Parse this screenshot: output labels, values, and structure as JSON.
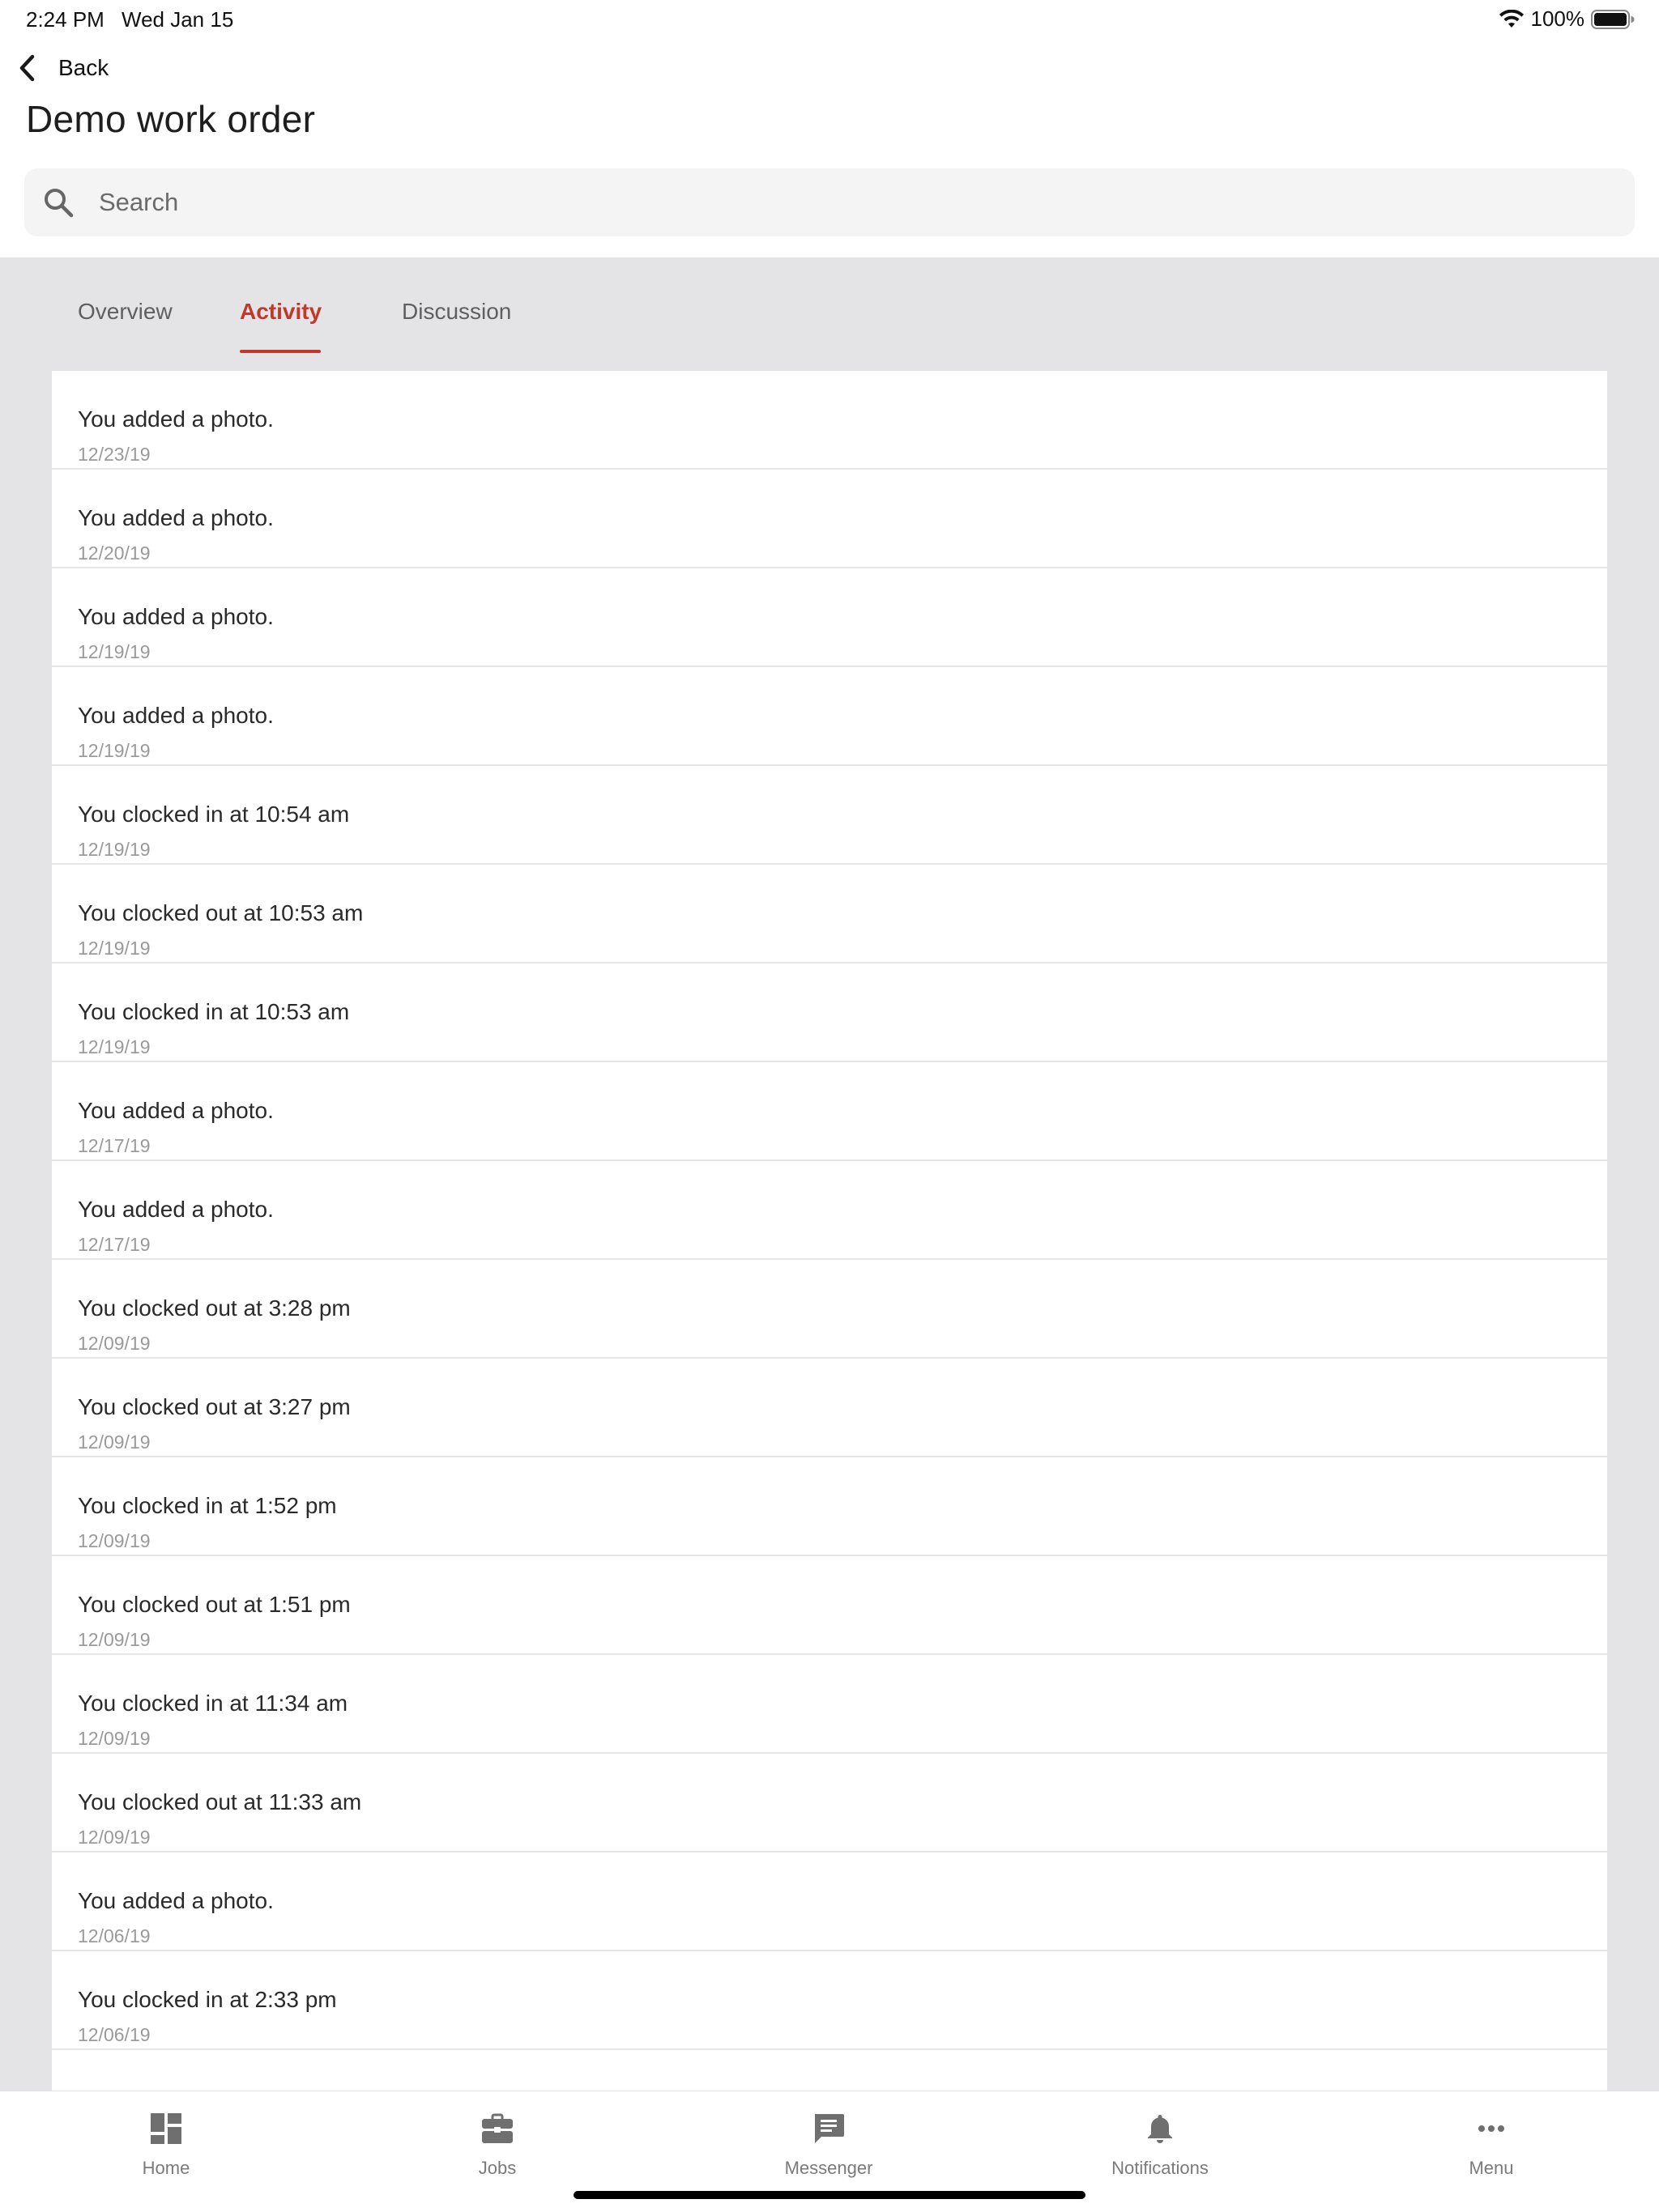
{
  "status_bar": {
    "time": "2:24 PM",
    "date": "Wed Jan 15",
    "battery": "100%",
    "icons": [
      "wifi-icon",
      "battery-icon"
    ]
  },
  "header": {
    "back_label": "Back",
    "title": "Demo work order"
  },
  "search": {
    "placeholder": "Search"
  },
  "tabs": [
    {
      "label": "Overview",
      "active": false
    },
    {
      "label": "Activity",
      "active": true
    },
    {
      "label": "Discussion",
      "active": false
    }
  ],
  "activity": [
    {
      "text": "You added a photo.",
      "date": "12/23/19"
    },
    {
      "text": "You added a photo.",
      "date": "12/20/19"
    },
    {
      "text": "You added a photo.",
      "date": "12/19/19"
    },
    {
      "text": "You added a photo.",
      "date": "12/19/19"
    },
    {
      "text": "You clocked in at 10:54 am",
      "date": "12/19/19"
    },
    {
      "text": "You clocked out at 10:53 am",
      "date": "12/19/19"
    },
    {
      "text": "You clocked in at 10:53 am",
      "date": "12/19/19"
    },
    {
      "text": "You added a photo.",
      "date": "12/17/19"
    },
    {
      "text": "You added a photo.",
      "date": "12/17/19"
    },
    {
      "text": "You clocked out at 3:28 pm",
      "date": "12/09/19"
    },
    {
      "text": "You clocked out at 3:27 pm",
      "date": "12/09/19"
    },
    {
      "text": "You clocked in at 1:52 pm",
      "date": "12/09/19"
    },
    {
      "text": "You clocked out at 1:51 pm",
      "date": "12/09/19"
    },
    {
      "text": "You clocked in at 11:34 am",
      "date": "12/09/19"
    },
    {
      "text": "You clocked out at 11:33 am",
      "date": "12/09/19"
    },
    {
      "text": "You added a photo.",
      "date": "12/06/19"
    },
    {
      "text": "You clocked in at 2:33 pm",
      "date": "12/06/19"
    }
  ],
  "bottom_nav": [
    {
      "label": "Home",
      "icon": "dashboard-icon"
    },
    {
      "label": "Jobs",
      "icon": "briefcase-icon"
    },
    {
      "label": "Messenger",
      "icon": "chat-icon"
    },
    {
      "label": "Notifications",
      "icon": "bell-icon"
    },
    {
      "label": "Menu",
      "icon": "more-icon"
    }
  ],
  "colors": {
    "accent": "#c0392b",
    "panel_bg": "#e4e4e6",
    "search_bg": "#f4f4f4",
    "nav_icon": "#6f6f6f"
  }
}
